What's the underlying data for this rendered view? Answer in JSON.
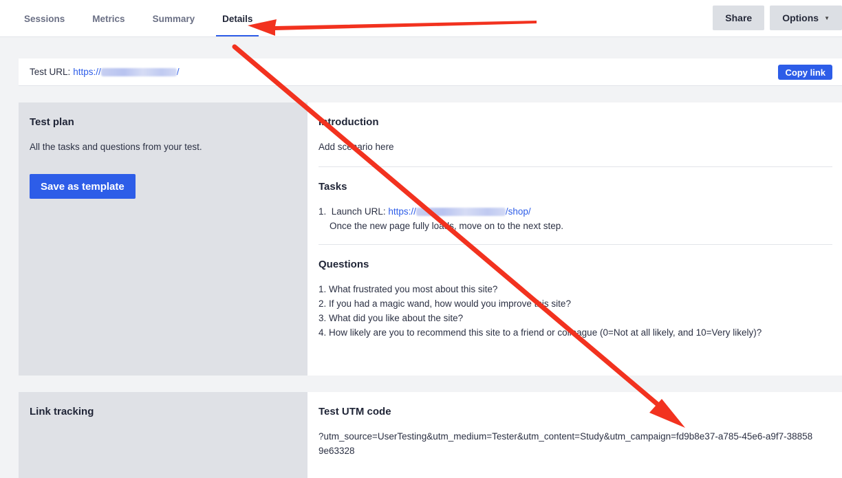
{
  "tabs": [
    {
      "label": "Sessions"
    },
    {
      "label": "Metrics"
    },
    {
      "label": "Summary"
    },
    {
      "label": "Details"
    }
  ],
  "actions": {
    "share": "Share",
    "options": "Options"
  },
  "url_bar": {
    "label": "Test URL:",
    "prefix": "https://",
    "suffix": "/",
    "copy": "Copy link"
  },
  "test_plan": {
    "title": "Test plan",
    "description": "All the tasks and questions from your test.",
    "save_button": "Save as template",
    "introduction": {
      "title": "Introduction",
      "text": "Add scenario here"
    },
    "tasks": {
      "title": "Tasks",
      "item_num": "1.",
      "item_label": "Launch URL:",
      "item_link_prefix": "https://",
      "item_link_suffix": "/shop/",
      "item_note": "Once the new page fully loads, move on to the next step."
    },
    "questions": {
      "title": "Questions",
      "items": [
        "1. What frustrated you most about this site?",
        "2. If you had a magic wand, how would you improve this site?",
        "3. What did you like about the site?",
        "4. How likely are you to recommend this site to a friend or colleague (0=Not at all likely, and 10=Very likely)?"
      ]
    }
  },
  "link_tracking": {
    "title": "Link tracking",
    "utm_title": "Test UTM code",
    "utm_code": "?utm_source=UserTesting&utm_medium=Tester&utm_content=Study&utm_campaign=fd9b8e37-a785-45e6-a9f7-388589e63328"
  },
  "colors": {
    "accent": "#2d5de8",
    "arrow": "#f2321f"
  }
}
